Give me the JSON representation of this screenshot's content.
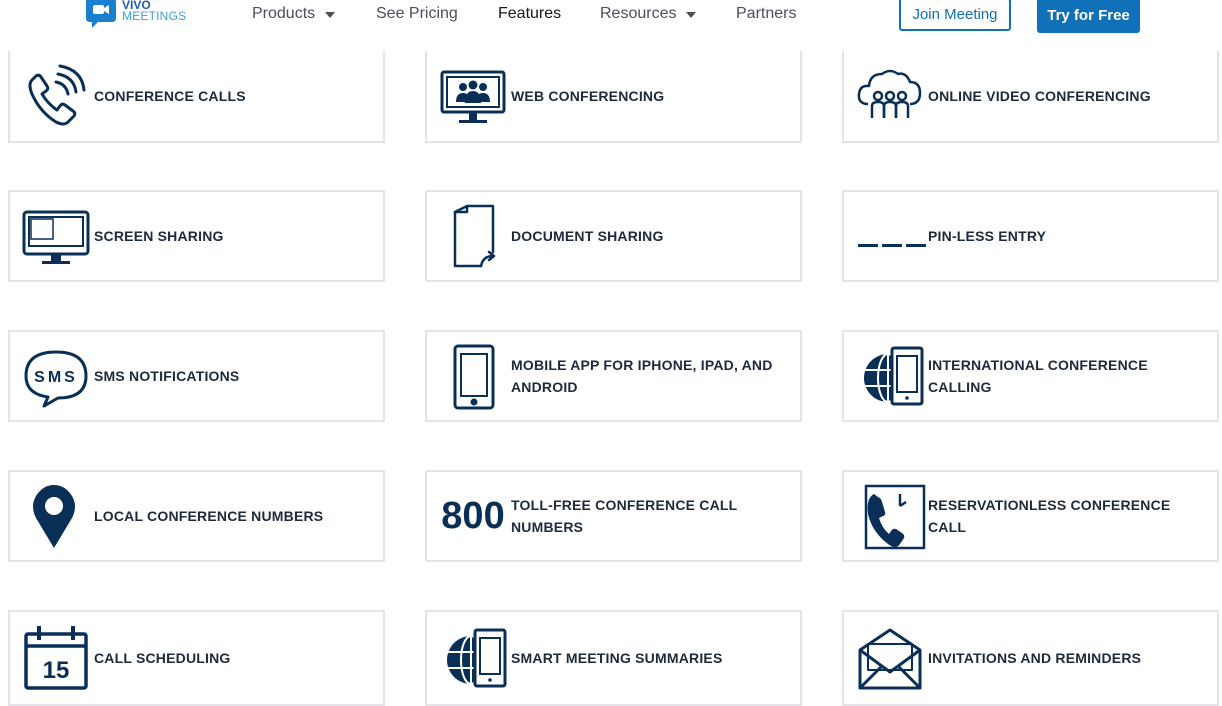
{
  "header": {
    "logo": {
      "line1": "VIVO",
      "line2": "MEETINGS"
    },
    "nav": [
      {
        "label": "Products",
        "dropdown": true
      },
      {
        "label": "See Pricing",
        "dropdown": false
      },
      {
        "label": "Features",
        "dropdown": false,
        "active": true
      },
      {
        "label": "Resources",
        "dropdown": true
      },
      {
        "label": "Partners",
        "dropdown": false
      }
    ],
    "join_label": "Join Meeting",
    "try_label": "Try for Free"
  },
  "colors": {
    "navy": "#0a2f57",
    "accent": "#1070b8",
    "border": "#e2e4e7"
  },
  "features": [
    {
      "label": "CONFERENCE CALLS",
      "icon": "phone-icon"
    },
    {
      "label": "WEB CONFERENCING",
      "icon": "monitor-people-icon"
    },
    {
      "label": "ONLINE VIDEO CONFERENCING",
      "icon": "cloud-people-icon"
    },
    {
      "label": "SCREEN SHARING",
      "icon": "screen-icon"
    },
    {
      "label": "DOCUMENT SHARING",
      "icon": "document-share-icon"
    },
    {
      "label": "PIN-LESS ENTRY",
      "icon": "pin-dashes-icon"
    },
    {
      "label": "SMS NOTIFICATIONS",
      "icon": "sms-bubble-icon",
      "icon_text": "SMS"
    },
    {
      "label": "MOBILE APP FOR IPHONE, IPAD, AND ANDROID",
      "icon": "mobile-icon"
    },
    {
      "label": "INTERNATIONAL CONFERENCE CALLING",
      "icon": "globe-phone-icon"
    },
    {
      "label": "LOCAL CONFERENCE NUMBERS",
      "icon": "map-pin-icon"
    },
    {
      "label": "TOLL-FREE CONFERENCE CALL NUMBERS",
      "icon": "toll-free-icon",
      "icon_text": "800"
    },
    {
      "label": "RESERVATIONLESS CONFERENCE CALL",
      "icon": "phone-clock-icon"
    },
    {
      "label": "CALL SCHEDULING",
      "icon": "calendar-icon",
      "icon_text": "15"
    },
    {
      "label": "SMART MEETING SUMMARIES",
      "icon": "globe-phone-icon"
    },
    {
      "label": "INVITATIONS AND REMINDERS",
      "icon": "envelope-icon"
    }
  ]
}
